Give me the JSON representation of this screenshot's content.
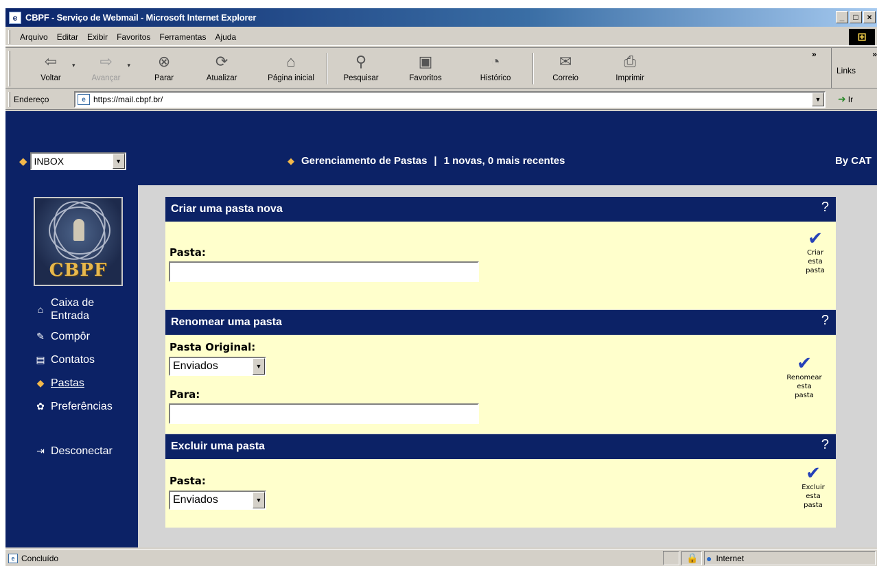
{
  "window": {
    "title": "CBPF - Serviço de Webmail - Microsoft Internet Explorer",
    "controls": [
      "_",
      "□",
      "×"
    ]
  },
  "menubar": {
    "items": [
      "Arquivo",
      "Editar",
      "Exibir",
      "Favoritos",
      "Ferramentas",
      "Ajuda"
    ]
  },
  "toolbar": {
    "back": "Voltar",
    "forward": "Avançar",
    "stop": "Parar",
    "refresh": "Atualizar",
    "home": "Página inicial",
    "search": "Pesquisar",
    "favorites": "Favoritos",
    "history": "Histórico",
    "mail": "Correio",
    "print": "Imprimir",
    "more": "»",
    "links": "Links"
  },
  "address": {
    "label": "Endereço",
    "url": "https://mail.cbpf.br/",
    "go": "Ir"
  },
  "webmail": {
    "folder_select": "INBOX",
    "header_title": "Gerenciamento de Pastas",
    "header_sep": "|",
    "header_status": "1 novas, 0 mais recentes",
    "by": "By CAT",
    "logo_text": "CBPF",
    "nav": {
      "inbox": "Caixa de Entrada",
      "compose": "Compôr",
      "contacts": "Contatos",
      "folders": "Pastas",
      "preferences": "Preferências",
      "logout": "Desconectar"
    },
    "sections": {
      "create": {
        "title": "Criar uma pasta nova",
        "help": "?",
        "label": "Pasta:",
        "value": "",
        "action": [
          "Criar",
          "esta",
          "pasta"
        ]
      },
      "rename": {
        "title": "Renomear uma pasta",
        "help": "?",
        "original_label": "Pasta Original:",
        "original_value": "Enviados",
        "to_label": "Para:",
        "to_value": "",
        "action": [
          "Renomear",
          "esta",
          "pasta"
        ]
      },
      "delete": {
        "title": "Excluir uma pasta",
        "help": "?",
        "label": "Pasta:",
        "value": "Enviados",
        "action": [
          "Excluir",
          "esta",
          "pasta"
        ]
      }
    }
  },
  "statusbar": {
    "status": "Concluído",
    "zone": "Internet"
  }
}
